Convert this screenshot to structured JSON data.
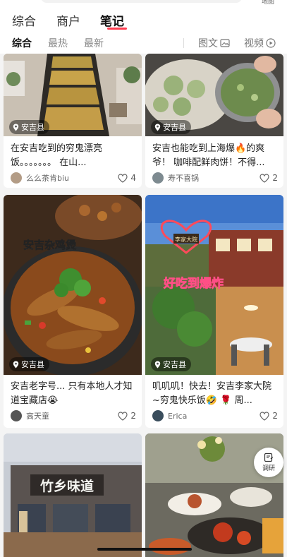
{
  "top": {
    "map_label": "地图"
  },
  "tabs": [
    {
      "label": "综合"
    },
    {
      "label": "商户"
    },
    {
      "label": "笔记"
    }
  ],
  "subtabs": [
    {
      "label": "综合"
    },
    {
      "label": "最热"
    },
    {
      "label": "最新"
    }
  ],
  "filters": [
    {
      "label": "图文",
      "icon": "image-icon"
    },
    {
      "label": "视频",
      "icon": "play-circle-icon"
    }
  ],
  "cards": [
    {
      "location": "安吉县",
      "title": "在安吉吃到的穷鬼漂亮饭。。。。。。。 在山...",
      "author": "么么茶肯biu",
      "likes": "4"
    },
    {
      "location": "安吉县",
      "title": "安吉也能吃到上海爆🔥的爽爷！ 咖啡配鲜肉饼！不得...",
      "author": "寿不喜锅",
      "likes": "2"
    },
    {
      "location": "安吉县",
      "title": "安吉老字号... 只有本地人才知道宝藏店😭",
      "author": "高天童",
      "likes": "2",
      "overlay_text": "安吉杂鸡煲"
    },
    {
      "location": "安吉县",
      "title": "叽叽叽！快去！安吉李家大院~穷鬼快乐饭🤣 🌹 周...",
      "author": "Erica",
      "likes": "2",
      "overlay_text": "好吃到爆炸",
      "sign_text": "李家大院"
    },
    {
      "sign_text": "竹乡味道"
    },
    {}
  ],
  "float_button": {
    "label": "调研",
    "icon": "edit-note-icon"
  }
}
